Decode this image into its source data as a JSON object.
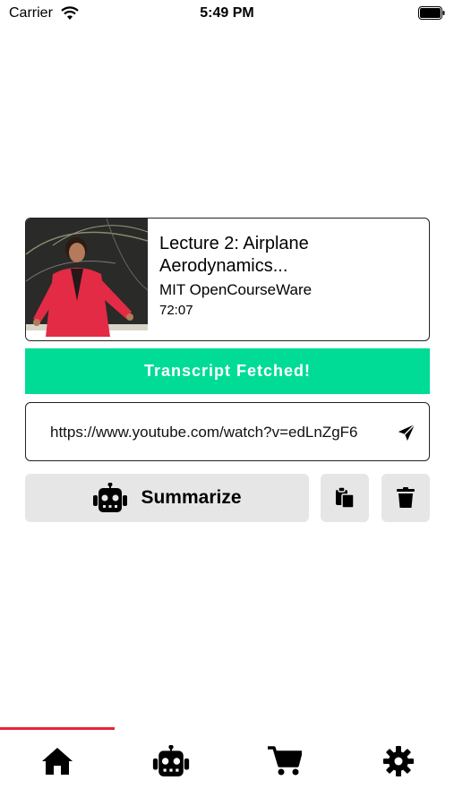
{
  "status_bar": {
    "carrier": "Carrier",
    "time": "5:49 PM"
  },
  "video": {
    "title": "Lecture 2: Airplane Aerodynamics...",
    "channel": "MIT OpenCourseWare",
    "duration": "72:07",
    "thumbnail_icon": "lecturer-thumbnail"
  },
  "status_banner": {
    "text": "Transcript Fetched!",
    "color": "#00dc96"
  },
  "url_input": {
    "value": "https://www.youtube.com/watch?v=edLnZgF6",
    "icon": "send-icon"
  },
  "actions": {
    "summarize_label": "Summarize",
    "summarize_icon": "robot-icon",
    "copy_icon": "paste-icon",
    "delete_icon": "trash-icon"
  },
  "tabs": [
    {
      "name": "home",
      "icon": "home-icon",
      "active": true
    },
    {
      "name": "robot",
      "icon": "robot-icon",
      "active": false
    },
    {
      "name": "cart",
      "icon": "cart-icon",
      "active": false
    },
    {
      "name": "settings",
      "icon": "gear-icon",
      "active": false
    }
  ],
  "colors": {
    "accent": "#e8243c",
    "success": "#00dc96",
    "button_bg": "#e6e6e6"
  }
}
